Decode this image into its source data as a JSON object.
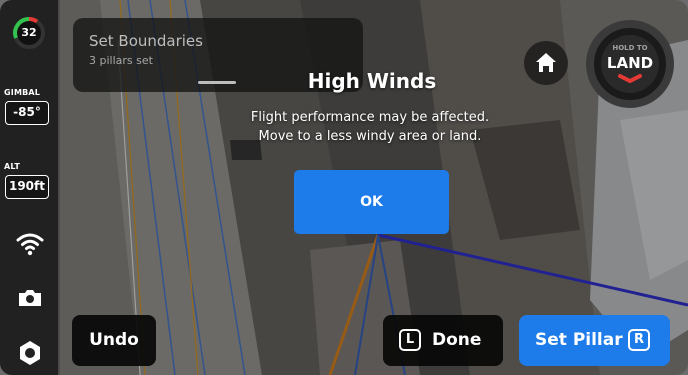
{
  "rail": {
    "battery_level": "32",
    "gimbal_label": "GIMBAL",
    "gimbal_value": "-85°",
    "alt_label": "ALT",
    "alt_value": "190ft"
  },
  "boundary_panel": {
    "title": "Set Boundaries",
    "subtitle": "3 pillars set"
  },
  "land_button": {
    "hold_text": "HOLD TO",
    "label": "LAND"
  },
  "alert": {
    "title": "High Winds",
    "line1": "Flight performance may be affected.",
    "line2": "Move to a less windy area or land.",
    "ok_label": "OK"
  },
  "bottom_bar": {
    "undo_label": "Undo",
    "done_key": "L",
    "done_label": "Done",
    "pillar_label": "Set Pillar",
    "pillar_key": "R"
  },
  "colors": {
    "accent_blue": "#1d7bea",
    "battery_green": "#33c24d",
    "battery_red": "#e53935",
    "land_red": "#e53935"
  },
  "icons": {
    "wifi": "wifi-icon",
    "camera": "camera-icon",
    "settings": "gear-icon",
    "home": "home-icon",
    "land": "land-chevron-icon"
  }
}
